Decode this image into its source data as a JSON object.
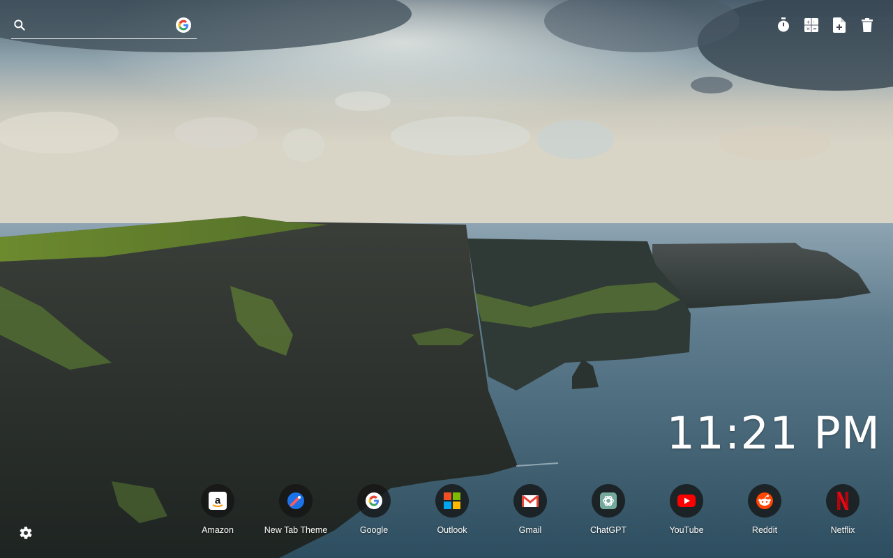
{
  "search": {
    "placeholder": "",
    "icon": "search-icon",
    "engine_icon": "google-icon"
  },
  "toolbar": [
    {
      "name": "timer-icon"
    },
    {
      "name": "calculator-icon"
    },
    {
      "name": "new-note-icon"
    },
    {
      "name": "trash-icon"
    }
  ],
  "clock": {
    "time": "11:21 PM"
  },
  "shortcuts": [
    {
      "label": "Amazon",
      "icon": "amazon-icon"
    },
    {
      "label": "New Tab Theme",
      "icon": "new-tab-theme-icon"
    },
    {
      "label": "Google",
      "icon": "google-icon"
    },
    {
      "label": "Outlook",
      "icon": "outlook-icon"
    },
    {
      "label": "Gmail",
      "icon": "gmail-icon"
    },
    {
      "label": "ChatGPT",
      "icon": "chatgpt-icon"
    },
    {
      "label": "YouTube",
      "icon": "youtube-icon"
    },
    {
      "label": "Reddit",
      "icon": "reddit-icon"
    },
    {
      "label": "Netflix",
      "icon": "netflix-icon"
    }
  ],
  "settings": {
    "icon": "gear-icon"
  },
  "colors": {
    "youtube": "#ff0000",
    "reddit": "#ff4500",
    "netflix": "#e50914",
    "gmail": "#ea4335",
    "new_tab_theme": "#1a73e8"
  }
}
